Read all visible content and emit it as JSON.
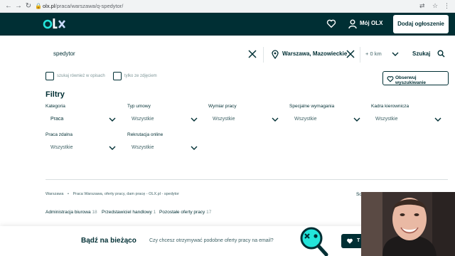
{
  "browser": {
    "url_host": "olx.pl",
    "url_path": "/praca/warszawa/q-spedytor/"
  },
  "header": {
    "logo_text": "olx",
    "account_label": "Mój OLX",
    "post_ad_label": "Dodaj ogłoszenie"
  },
  "search": {
    "query": "spedytor",
    "location": "Warszawa, Mazowieckie",
    "distance": "+ 0 km",
    "search_label": "Szukaj"
  },
  "options": {
    "descriptions_label": "szukaj również w opisach",
    "photos_label": "tylko ze zdjęciem",
    "observe_label": "Obserwuj wyszukiwanie"
  },
  "filters": {
    "title": "Filtry",
    "items": [
      {
        "label": "Kategoria",
        "value": "Praca"
      },
      {
        "label": "Typ umowy",
        "value": "Wszystkie"
      },
      {
        "label": "Wymiar pracy",
        "value": "Wszystkie"
      },
      {
        "label": "Specjalne wymagania",
        "value": "Wszystkie"
      },
      {
        "label": "Kadra kierownicza",
        "value": "Wszystkie"
      },
      {
        "label": "Praca zdalna",
        "value": "Wszystkie"
      },
      {
        "label": "Rekrutacja online",
        "value": "Wszystkie"
      }
    ]
  },
  "breadcrumb": {
    "home": "Warszawa",
    "sep": "•",
    "current": "Praca Warszawa, oferty pracy, dam pracę - OLX.pl - spedytor"
  },
  "sort_label": "So",
  "categories": [
    {
      "name": "Administracja biurowa",
      "count": "18"
    },
    {
      "name": "Przedstawiciel handlowy",
      "count": "1"
    },
    {
      "name": "Pozostałe oferty pracy",
      "count": "17"
    }
  ],
  "newsletter": {
    "title": "Bądź na bieżąco",
    "question": "Czy chcesz otrzymywać podobne oferty pracy na email?",
    "button": "T"
  },
  "colors": {
    "brand_dark": "#002f34",
    "brand_teal": "#23e5db"
  }
}
